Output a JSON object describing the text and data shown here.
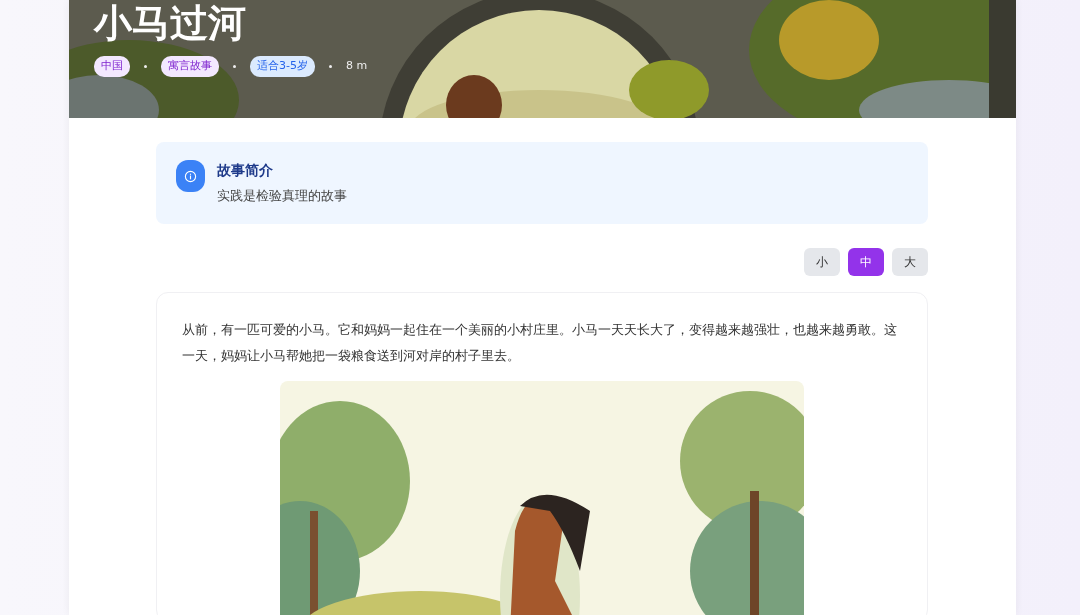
{
  "story": {
    "title": "小马过河",
    "tags": [
      {
        "label": "中国",
        "color": "#f3e8ff"
      },
      {
        "label": "寓言故事",
        "color": "#f3e8ff"
      },
      {
        "label": "适合3-5岁",
        "color": "#dbeafe"
      }
    ],
    "duration": "8 m",
    "summary": {
      "heading": "故事简介",
      "text": "实践是检验真理的故事"
    },
    "font_sizes": [
      {
        "label": "小",
        "selected": false
      },
      {
        "label": "中",
        "selected": true
      },
      {
        "label": "大",
        "selected": false
      }
    ],
    "paragraphs": [
      "从前，有一匹可爱的小马。它和妈妈一起住在一个美丽的小村庄里。小马一天天长大了，变得越来越强壮，也越来越勇敢。这一天，妈妈让小马帮她把一袋粮食送到河对岸的村子里去。"
    ]
  }
}
